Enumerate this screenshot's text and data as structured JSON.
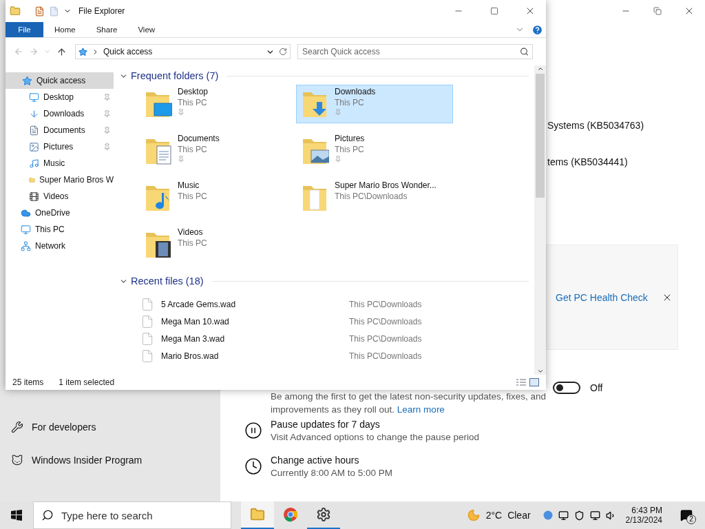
{
  "settings_window": {
    "partial_lines": [
      "Systems (KB5034763)",
      "tems (KB5034441)"
    ],
    "health_card": {
      "link": "Get PC Health Check"
    },
    "toggle": {
      "on": false,
      "label": "Off"
    },
    "preview_text": "Be among the first to get the latest non-security updates, fixes, and improvements as they roll out.",
    "preview_link": "Learn more",
    "options": [
      {
        "kind": "pause",
        "title": "Pause updates for 7 days",
        "subtitle": "Visit Advanced options to change the pause period"
      },
      {
        "kind": "clock",
        "title": "Change active hours",
        "subtitle": "Currently 8:00 AM to 5:00 PM"
      }
    ],
    "sidebar": [
      {
        "kind": "dev",
        "label": "For developers"
      },
      {
        "kind": "insider",
        "label": "Windows Insider Program"
      }
    ]
  },
  "explorer": {
    "title": "File Explorer",
    "ribbon_tabs": [
      {
        "label": "File",
        "selected": true
      },
      {
        "label": "Home",
        "selected": false
      },
      {
        "label": "Share",
        "selected": false
      },
      {
        "label": "View",
        "selected": false
      }
    ],
    "address": "Quick access",
    "search": {
      "placeholder": "Search Quick access"
    },
    "nav": [
      {
        "kind": "star",
        "label": "Quick access",
        "selected": true,
        "children": [
          {
            "kind": "desktop",
            "label": "Desktop",
            "pinned": true,
            "selected": false
          },
          {
            "kind": "downloads",
            "label": "Downloads",
            "pinned": true,
            "selected": false
          },
          {
            "kind": "documents",
            "label": "Documents",
            "pinned": true,
            "selected": false
          },
          {
            "kind": "pictures",
            "label": "Pictures",
            "pinned": true,
            "selected": false
          },
          {
            "kind": "music",
            "label": "Music",
            "pinned": false,
            "selected": false
          },
          {
            "kind": "folder",
            "label": "Super Mario Bros W",
            "pinned": false,
            "selected": false
          },
          {
            "kind": "videos",
            "label": "Videos",
            "pinned": false,
            "selected": false
          }
        ]
      },
      {
        "kind": "cloud",
        "label": "OneDrive",
        "selected": false
      },
      {
        "kind": "pc",
        "label": "This PC",
        "selected": false
      },
      {
        "kind": "network",
        "label": "Network",
        "selected": false
      }
    ],
    "frequent": {
      "heading": "Frequent folders (7)",
      "folders": [
        {
          "kind": "desktop",
          "name": "Desktop",
          "location": "This PC",
          "pinned": true,
          "selected": false
        },
        {
          "kind": "downloads",
          "name": "Downloads",
          "location": "This PC",
          "pinned": true,
          "selected": true
        },
        {
          "kind": "documents",
          "name": "Documents",
          "location": "This PC",
          "pinned": true,
          "selected": false
        },
        {
          "kind": "pictures",
          "name": "Pictures",
          "location": "This PC",
          "pinned": true,
          "selected": false
        },
        {
          "kind": "music",
          "name": "Music",
          "location": "This PC",
          "pinned": false,
          "selected": false
        },
        {
          "kind": "plain",
          "name": "Super Mario Bros Wonder...",
          "location": "This PC\\Downloads",
          "pinned": false,
          "selected": false
        },
        {
          "kind": "videos",
          "name": "Videos",
          "location": "This PC",
          "pinned": false,
          "selected": false
        }
      ]
    },
    "recent": {
      "heading": "Recent files (18)",
      "files": [
        {
          "name": "5 Arcade Gems.wad",
          "location": "This PC\\Downloads"
        },
        {
          "name": "Mega Man 10.wad",
          "location": "This PC\\Downloads"
        },
        {
          "name": "Mega Man 3.wad",
          "location": "This PC\\Downloads"
        },
        {
          "name": "Mario Bros.wad",
          "location": "This PC\\Downloads"
        }
      ]
    },
    "status": {
      "items": "25 items",
      "selection": "1 item selected"
    }
  },
  "taskbar": {
    "search": {
      "placeholder": "Type here to search"
    },
    "apps": [
      {
        "kind": "explorer",
        "selected": true,
        "running": true
      },
      {
        "kind": "chrome",
        "selected": false,
        "running": false
      },
      {
        "kind": "settings",
        "selected": false,
        "running": true
      }
    ],
    "weather": {
      "temp": "2°C",
      "condition": "Clear"
    },
    "time": "6:43 PM",
    "date": "2/13/2024",
    "notifications": "2"
  }
}
